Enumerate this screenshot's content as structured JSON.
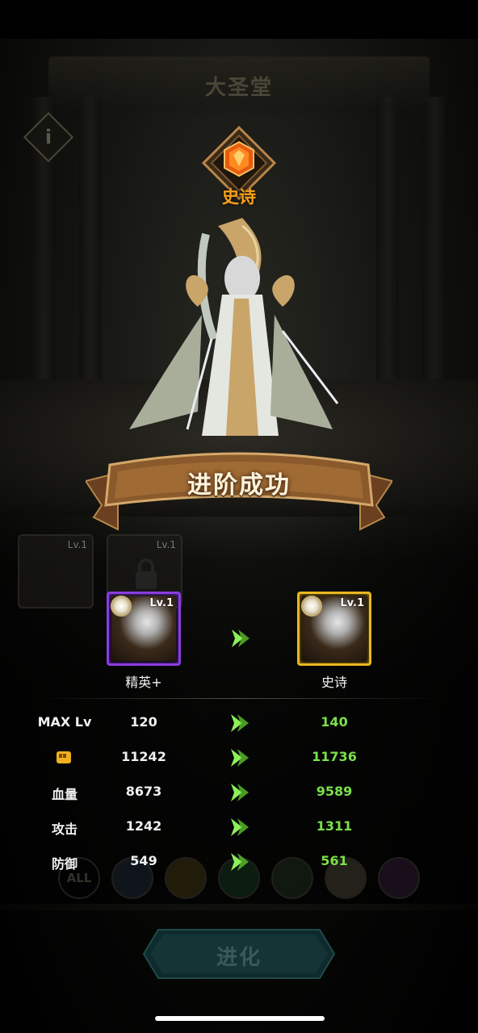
{
  "header": {
    "title": "大圣堂",
    "info_icon": "i"
  },
  "rarity": {
    "label": "史诗",
    "icon": "amber-gem-icon",
    "color": "#f4a21c"
  },
  "banner": {
    "text": "进阶成功"
  },
  "evolution": {
    "from": {
      "label": "精英+",
      "level": "Lv.1",
      "frame_color": "#8a3de0"
    },
    "to": {
      "label": "史诗",
      "level": "Lv.1",
      "frame_color": "#e8b820"
    }
  },
  "background_cards": [
    {
      "level": "Lv.1"
    },
    {
      "level": "Lv.1"
    }
  ],
  "stats": [
    {
      "name": "MAX Lv",
      "old": "120",
      "new": "140"
    },
    {
      "name": "",
      "icon": "power-fist-icon",
      "old": "11242",
      "new": "11736"
    },
    {
      "name": "血量",
      "old": "8673",
      "new": "9589"
    },
    {
      "name": "攻击",
      "old": "1242",
      "new": "1311"
    },
    {
      "name": "防御",
      "old": "549",
      "new": "561"
    }
  ],
  "filter_bar": {
    "all_label": "ALL"
  },
  "actions": {
    "evolve_label": "进化"
  },
  "colors": {
    "increase": "#7be04a",
    "arrow": "#8ef05a"
  }
}
